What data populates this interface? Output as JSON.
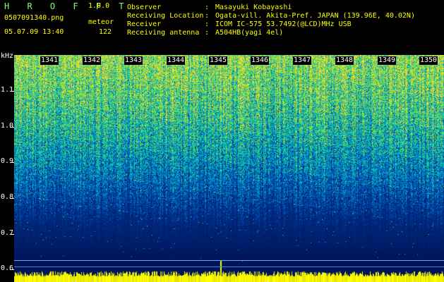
{
  "header": {
    "app_name": "H R O F F T",
    "version": "1.0.0",
    "filename": "0507091340.png",
    "event_type": "meteor",
    "datetime": "05.07.09 13:40",
    "count": "122",
    "fields": [
      {
        "label": "Observer",
        "sep": ":",
        "value": "Masayuki Kobayashi"
      },
      {
        "label": "Receiving Location",
        "sep": ":",
        "value": "Ogata-vill. Akita-Pref. JAPAN (139.96E, 40.02N)"
      },
      {
        "label": "Receiver",
        "sep": ":",
        "value": "ICOM IC-575 53.7492(@LCD)MHz USB"
      },
      {
        "label": "Receiving antenna",
        "sep": ":",
        "value": "A504HB(yagi 4el)"
      }
    ]
  },
  "axis": {
    "unit": "kHz",
    "ticks": [
      "1.1",
      "1.0",
      "0.9",
      "0.8",
      "0.7",
      "0.6"
    ],
    "time_labels": [
      "1341",
      "1342",
      "1343",
      "1344",
      "1345",
      "1346",
      "1347",
      "1348",
      "1349",
      "1350"
    ]
  },
  "colors": {
    "background": "#000000",
    "brand": "#7fff7f",
    "header_text": "#ffff00",
    "spectrogram_base": "#00125a",
    "signal_band": "#ffff00"
  }
}
